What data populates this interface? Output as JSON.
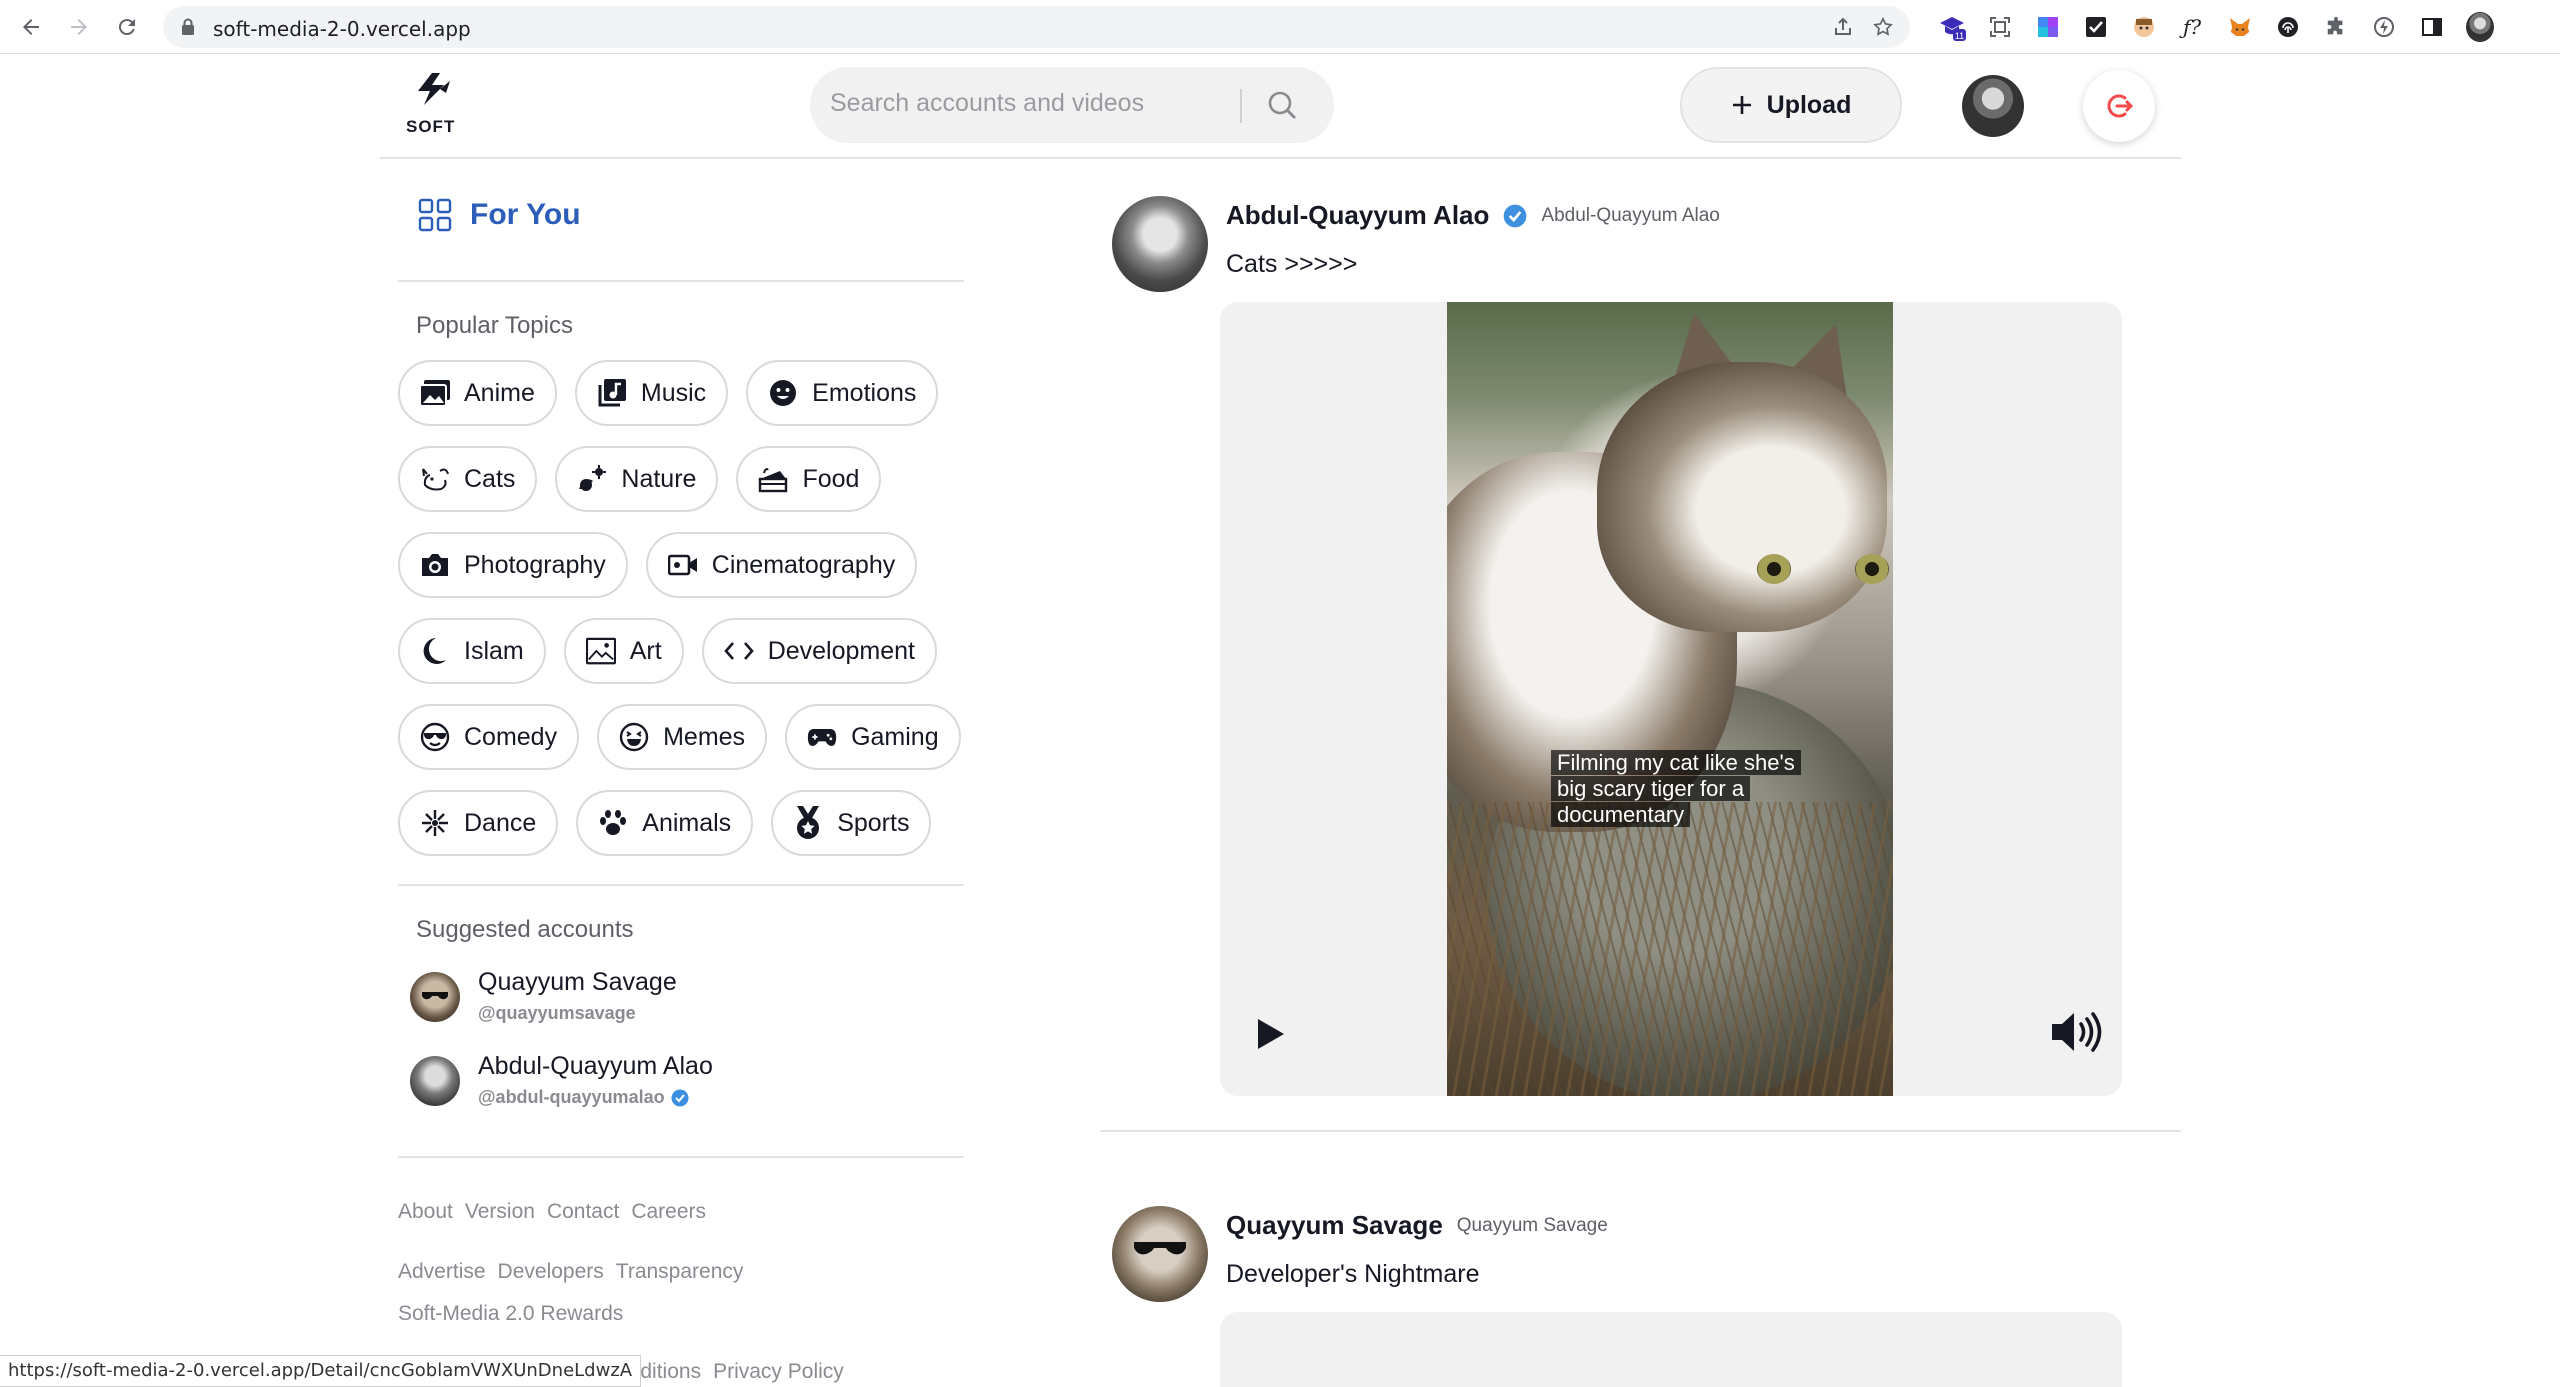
{
  "browser": {
    "url": "soft-media-2-0.vercel.app",
    "status_url": "https://soft-media-2-0.vercel.app/Detail/cncGoblamVWXUnDneLdwzA",
    "extension_badge": "11"
  },
  "header": {
    "logo_text": "SOFT",
    "search_placeholder": "Search accounts and videos",
    "upload_label": "Upload",
    "accent_color": "#f34b4b"
  },
  "sidebar": {
    "for_you_label": "For You",
    "popular_topics_title": "Popular Topics",
    "topic_rows": [
      [
        {
          "label": "Anime",
          "icon": "image-gallery-icon"
        },
        {
          "label": "Music",
          "icon": "music-library-icon"
        },
        {
          "label": "Emotions",
          "icon": "smile-face-icon"
        }
      ],
      [
        {
          "label": "Cats",
          "icon": "cat-icon"
        },
        {
          "label": "Nature",
          "icon": "nature-icon"
        },
        {
          "label": "Food",
          "icon": "cake-icon"
        }
      ],
      [
        {
          "label": "Photography",
          "icon": "camera-icon"
        },
        {
          "label": "Cinematography",
          "icon": "video-camera-icon"
        }
      ],
      [
        {
          "label": "Islam",
          "icon": "crescent-star-icon"
        },
        {
          "label": "Art",
          "icon": "picture-icon"
        },
        {
          "label": "Development",
          "icon": "code-icon"
        }
      ],
      [
        {
          "label": "Comedy",
          "icon": "sunglasses-face-icon"
        },
        {
          "label": "Memes",
          "icon": "laughing-face-icon"
        },
        {
          "label": "Gaming",
          "icon": "gamepad-icon"
        }
      ],
      [
        {
          "label": "Dance",
          "icon": "dance-icon"
        },
        {
          "label": "Animals",
          "icon": "paw-icon"
        },
        {
          "label": "Sports",
          "icon": "medal-icon"
        }
      ]
    ],
    "suggested_title": "Suggested accounts",
    "suggested": [
      {
        "name": "Quayyum Savage",
        "handle": "@quayyumsavage",
        "verified": false
      },
      {
        "name": "Abdul-Quayyum Alao",
        "handle": "@abdul-quayyumalao",
        "verified": true
      }
    ],
    "footer_row1": [
      "About",
      "Version",
      "Contact",
      "Careers"
    ],
    "footer_row2": [
      "Advertise",
      "Developers",
      "Transparency"
    ],
    "footer_row3": [
      "Soft-Media 2.0 Rewards"
    ],
    "footer_row4": [
      "& Conditions",
      "Privacy Policy"
    ]
  },
  "feed": {
    "posts": [
      {
        "name": "Abdul-Quayyum Alao",
        "subname": "Abdul-Quayyum Alao",
        "verified": true,
        "caption": "Cats >>>>>",
        "video_subtitle": "Filming my cat like she's big scary tiger for a documentary"
      },
      {
        "name": "Quayyum Savage",
        "subname": "Quayyum Savage",
        "verified": false,
        "caption": "Developer's Nightmare"
      }
    ]
  }
}
